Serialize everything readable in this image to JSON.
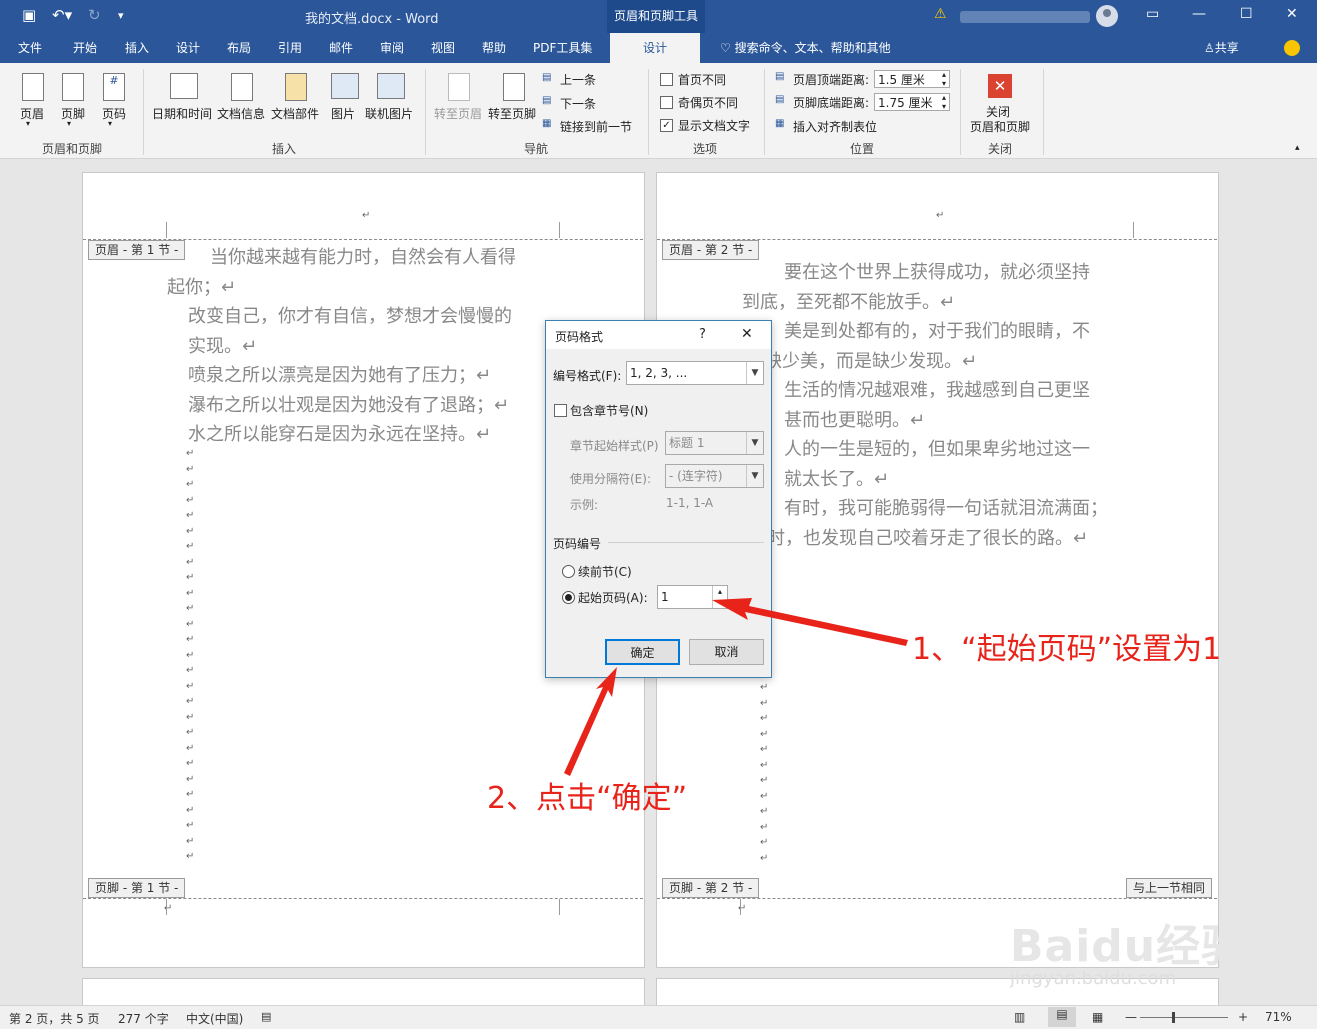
{
  "titlebar": {
    "document_title": "我的文档.docx  -  Word",
    "context_tab_title": "页眉和页脚工具"
  },
  "tabs": [
    {
      "label": "文件"
    },
    {
      "label": "开始"
    },
    {
      "label": "插入"
    },
    {
      "label": "设计"
    },
    {
      "label": "布局"
    },
    {
      "label": "引用"
    },
    {
      "label": "邮件"
    },
    {
      "label": "审阅"
    },
    {
      "label": "视图"
    },
    {
      "label": "帮助"
    },
    {
      "label": "PDF工具集"
    },
    {
      "label": "设计"
    }
  ],
  "tell_me": "搜索命令、文本、帮助和其他",
  "share_label": "共享",
  "ribbon": {
    "groups": {
      "header_footer": "页眉和页脚",
      "insert": "插入",
      "navigation": "导航",
      "options": "选项",
      "position": "位置",
      "close": "关闭"
    },
    "buttons": {
      "header": "页眉",
      "footer": "页脚",
      "page_number": "页码",
      "date_time": "日期和时间",
      "doc_info": "文档信息",
      "doc_parts": "文档部件",
      "picture": "图片",
      "online_picture": "联机图片",
      "goto_header": "转至页眉",
      "goto_footer": "转至页脚",
      "previous": "上一条",
      "next": "下一条",
      "link_previous": "链接到前一节",
      "close_line1": "关闭",
      "close_line2": "页眉和页脚"
    },
    "options": {
      "different_first": "首页不同",
      "odd_even": "奇偶页不同",
      "show_text": "显示文档文字"
    },
    "position": {
      "header_top_label": "页眉顶端距离:",
      "header_top_value": "1.5 厘米",
      "footer_bottom_label": "页脚底端距离:",
      "footer_bottom_value": "1.75 厘米",
      "insert_align_tab": "插入对齐制表位"
    }
  },
  "pages": {
    "left": {
      "header_tag": "页眉 - 第 1 节 -",
      "footer_tag": "页脚 - 第 1 节 -",
      "lines": [
        "当你越来越有能力时，自然会有人看得",
        "起你；↵",
        "改变自己，你才有自信，梦想才会慢慢的",
        "实现。↵",
        "喷泉之所以漂亮是因为她有了压力；↵",
        "瀑布之所以壮观是因为她没有了退路；↵",
        "水之所以能穿石是因为永远在坚持。↵"
      ]
    },
    "right": {
      "header_tag": "页眉 - 第 2 节 -",
      "footer_tag": "页脚 - 第 2 节 -",
      "same_as_previous": "与上一节相同",
      "lines": [
        "要在这个世界上获得成功，就必须坚持",
        "到底，至死都不能放手。↵",
        "美是到处都有的，对于我们的眼睛，不",
        "缺少美，而是缺少发现。↵",
        "生活的情况越艰难，我越感到自己更坚",
        "甚而也更聪明。↵",
        "人的一生是短的，但如果卑劣地过这一",
        "就太长了。↵",
        "有时，我可能脆弱得一句话就泪流满面；",
        "时，也发现自己咬着牙走了很长的路。↵"
      ]
    }
  },
  "dialog": {
    "title": "页码格式",
    "help": "?",
    "number_format_label": "编号格式(F):",
    "number_format_value": "1, 2, 3, ...",
    "include_chapter_label": "包含章节号(N)",
    "chapter_style_label": "章节起始样式(P)",
    "chapter_style_value": "标题 1",
    "separator_label": "使用分隔符(E):",
    "separator_value": "-  (连字符)",
    "example_label": "示例:",
    "example_value": "1-1, 1-A",
    "numbering_section": "页码编号",
    "continue_label": "续前节(C)",
    "start_at_label": "起始页码(A):",
    "start_at_value": "1",
    "ok": "确定",
    "cancel": "取消"
  },
  "annotations": {
    "step1": "1、“起始页码”设置为1",
    "step2": "2、点击“确定”"
  },
  "statusbar": {
    "page": "第 2 页，共 5 页",
    "words": "277 个字",
    "language": "中文(中国)",
    "zoom": "71%"
  },
  "watermark": {
    "text": "Baidu经验",
    "url": "jingyan.baidu.com"
  },
  "colors": {
    "word_blue": "#2b579a",
    "annotation_red": "#e8231a",
    "dialog_border": "#3c7fb1"
  }
}
